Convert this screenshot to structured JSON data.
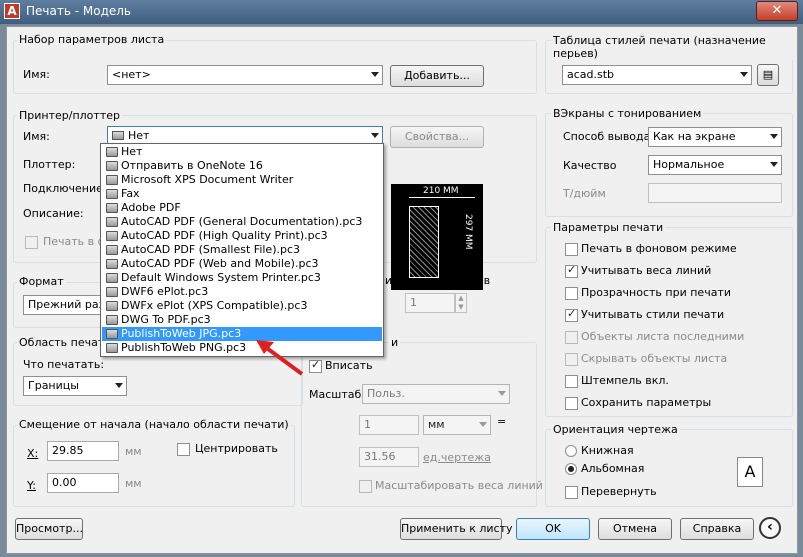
{
  "window": {
    "title": "Печать - Модель",
    "logo": "A",
    "close": "✕"
  },
  "page_setup": {
    "group": "Набор параметров листа",
    "name_label": "Имя:",
    "name_value": "<нет>",
    "add_button": "Добавить..."
  },
  "plotter": {
    "group": "Принтер/плоттер",
    "name_label": "Имя:",
    "name_value": "Нет",
    "properties_button": "Свойства...",
    "plotter_label": "Плоттер:",
    "connection_label": "Подключение:",
    "description_label": "Описание:",
    "print_to_file": "Печать в фай",
    "options": [
      "Нет",
      "Отправить в OneNote 16",
      "Microsoft XPS Document Writer",
      "Fax",
      "Adobe PDF",
      "AutoCAD PDF (General Documentation).pc3",
      "AutoCAD PDF (High Quality Print).pc3",
      "AutoCAD PDF (Smallest File).pc3",
      "AutoCAD PDF (Web and Mobile).pc3",
      "Default Windows System Printer.pc3",
      "DWF6 ePlot.pc3",
      "DWFx ePlot (XPS Compatible).pc3",
      "DWG To PDF.pc3",
      "PublishToWeb JPG.pc3",
      "PublishToWeb PNG.pc3"
    ],
    "selected_index": 13,
    "preview_width": "210 ММ",
    "preview_height": "297 ММ"
  },
  "format": {
    "group": "Формат",
    "value": "Прежний размер"
  },
  "copies": {
    "label": "исло экземпляров",
    "value": "1"
  },
  "plot_area": {
    "group": "Область печати",
    "what_label": "Что печатать:",
    "what_value": "Границы"
  },
  "offset": {
    "group": "Смещение от начала (начало области печати)",
    "x_label": "X:",
    "x_value": "29.85",
    "y_label": "Y:",
    "y_value": "0.00",
    "unit": "мм",
    "center": "Центрировать"
  },
  "scale": {
    "fit": "Вписать",
    "scale_label": "Масштаб:",
    "scale_value": "Польз.",
    "num": "1",
    "unit": "мм",
    "eq": "=",
    "den": "31.56",
    "unit2": "ед.чертежа",
    "lineweights": "Масштабировать веса линий",
    "group_tail": "и"
  },
  "style_table": {
    "group": "Таблица стилей печати (назначение перьев)",
    "value": "acad.stb"
  },
  "shaded": {
    "group": "ВЭкраны с тонированием",
    "output_label": "Способ вывода",
    "output_value": "Как на экране",
    "quality_label": "Качество",
    "quality_value": "Нормальное",
    "dpi_label": "Т/дюйм"
  },
  "options": {
    "group": "Параметры печати",
    "items": [
      {
        "label": "Печать в фоновом режиме",
        "checked": false,
        "enabled": true
      },
      {
        "label": "Учитывать веса линий",
        "checked": true,
        "enabled": true
      },
      {
        "label": "Прозрачность при печати",
        "checked": false,
        "enabled": true
      },
      {
        "label": "Учитывать стили печати",
        "checked": true,
        "enabled": true
      },
      {
        "label": "Объекты листа последними",
        "checked": false,
        "enabled": false
      },
      {
        "label": "Скрывать объекты листа",
        "checked": false,
        "enabled": false
      },
      {
        "label": "Штемпель вкл.",
        "checked": false,
        "enabled": true
      },
      {
        "label": "Сохранить параметры",
        "checked": false,
        "enabled": true
      }
    ]
  },
  "orientation": {
    "group": "Ориентация чертежа",
    "portrait": "Книжная",
    "landscape": "Альбомная",
    "reverse": "Перевернуть",
    "icon_letter": "A"
  },
  "footer": {
    "preview": "Просмотр...",
    "apply": "Применить к листу",
    "ok": "OK",
    "cancel": "Отмена",
    "help": "Справка",
    "collapse": "‹"
  }
}
